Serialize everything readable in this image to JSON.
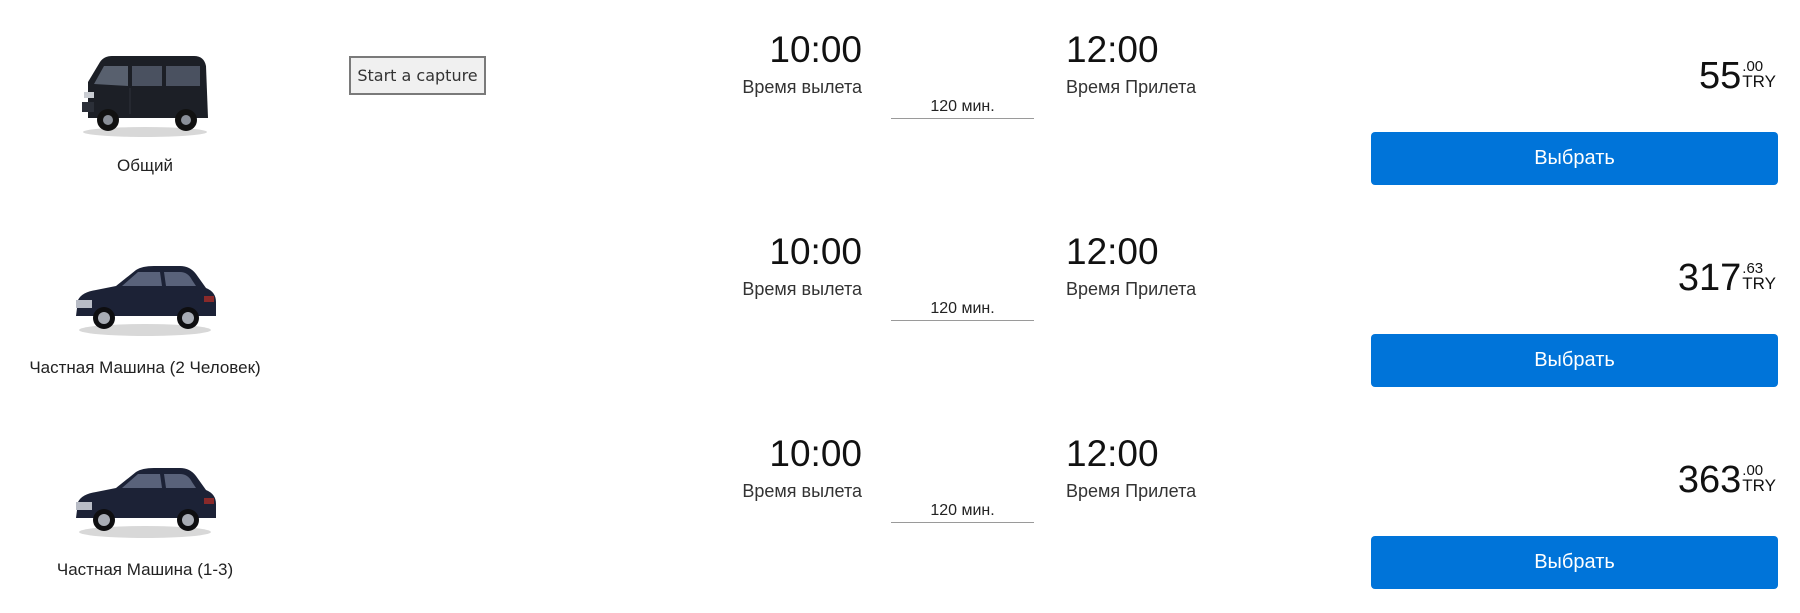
{
  "capture_button": {
    "label": "Start a capture"
  },
  "transfers": [
    {
      "vehicle_name": "Общий",
      "vehicle_icon": "van-icon",
      "departure_time": "10:00",
      "departure_label": "Время вылета",
      "duration": "120 мин.",
      "arrival_time": "12:00",
      "arrival_label": "Время Прилета",
      "price_int": "55",
      "price_dec": ".00",
      "currency": "TRY",
      "select_label": "Выбрать"
    },
    {
      "vehicle_name": "Частная Машина (2 Человек)",
      "vehicle_icon": "sedan-icon",
      "departure_time": "10:00",
      "departure_label": "Время вылета",
      "duration": "120 мин.",
      "arrival_time": "12:00",
      "arrival_label": "Время Прилета",
      "price_int": "317",
      "price_dec": ".63",
      "currency": "TRY",
      "select_label": "Выбрать"
    },
    {
      "vehicle_name": "Частная Машина (1-3)",
      "vehicle_icon": "sedan-icon",
      "departure_time": "10:00",
      "departure_label": "Время вылета",
      "duration": "120 мин.",
      "arrival_time": "12:00",
      "arrival_label": "Время Прилета",
      "price_int": "363",
      "price_dec": ".00",
      "currency": "TRY",
      "select_label": "Выбрать"
    }
  ],
  "colors": {
    "button_bg": "#0074d9",
    "button_text": "#ffffff",
    "vehicle_body": "#1a1f2e"
  }
}
